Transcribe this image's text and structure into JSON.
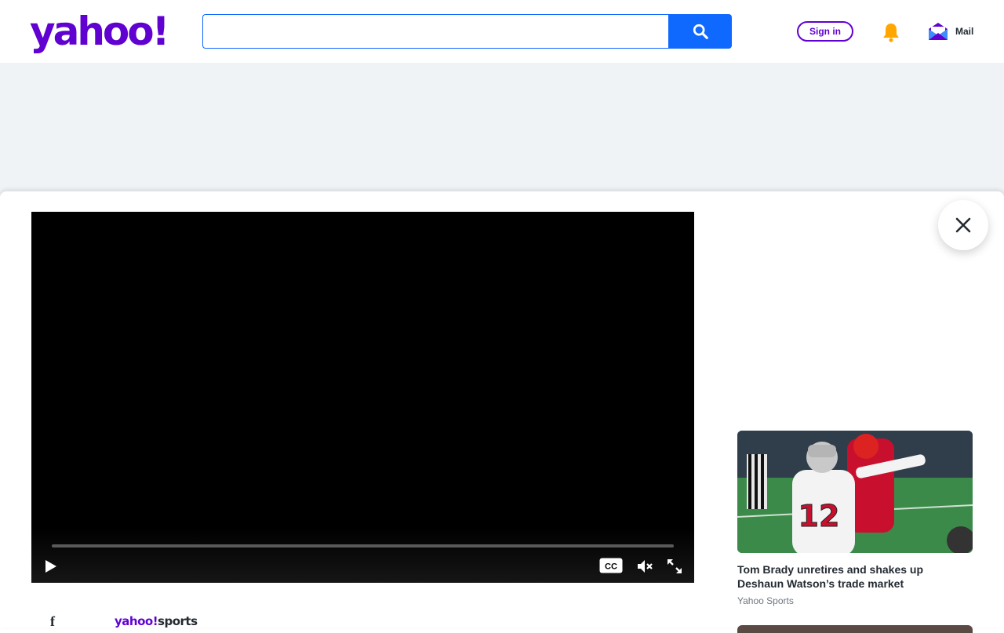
{
  "header": {
    "logo_text": "yahoo!",
    "search": {
      "placeholder": "",
      "value": ""
    },
    "signin_label": "Sign in",
    "mail_label": "Mail"
  },
  "video": {
    "progress": 0,
    "controls": [
      "play-icon",
      "closed-captions-icon",
      "muted-speaker-icon",
      "fullscreen-icon"
    ]
  },
  "footer": {
    "brand_yahoo": "yahoo!",
    "brand_section": "sports"
  },
  "related": [
    {
      "title": "Tom Brady unretires and shakes up Deshaun Watson’s trade market",
      "source": "Yahoo Sports",
      "jersey_number": "12"
    }
  ],
  "colors": {
    "brand": "#6001d2",
    "search_blue": "#0f69ff",
    "ad_band": "#f0f3f5",
    "bell": "#ffa700",
    "mail": "#6001d2"
  }
}
